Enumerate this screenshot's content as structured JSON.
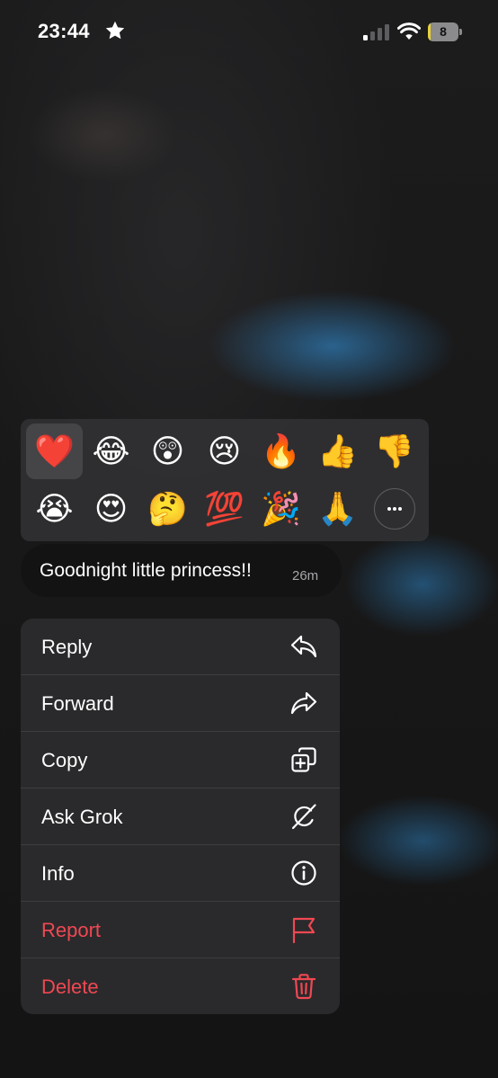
{
  "status_bar": {
    "time": "23:44",
    "battery_level": "8",
    "battery_fraction": 0.08
  },
  "reactions": {
    "row1": [
      "❤️",
      "😂",
      "😲",
      "😢",
      "🔥",
      "👍",
      "👎"
    ],
    "row2": [
      "😭",
      "😍",
      "🤔",
      "💯",
      "🎉",
      "🙏"
    ],
    "selected_index": 0
  },
  "message": {
    "text": "Goodnight little princess!!",
    "time": "26m"
  },
  "menu": {
    "reply": "Reply",
    "forward": "Forward",
    "copy": "Copy",
    "ask_grok": "Ask Grok",
    "info": "Info",
    "report": "Report",
    "delete": "Delete"
  },
  "colors": {
    "destructive": "#f04852",
    "menu_background": "#2b2b2d",
    "panel_background": "#303032",
    "bubble_background": "#131314",
    "battery_fill": "#e8d23a"
  },
  "icons": {
    "status": [
      "star-icon",
      "cellular-signal-icon",
      "wifi-icon",
      "battery-icon"
    ],
    "menu": [
      "reply-icon",
      "forward-icon",
      "copy-icon",
      "grok-icon",
      "info-icon",
      "flag-icon",
      "trash-icon"
    ],
    "more": "ellipsis-icon"
  }
}
